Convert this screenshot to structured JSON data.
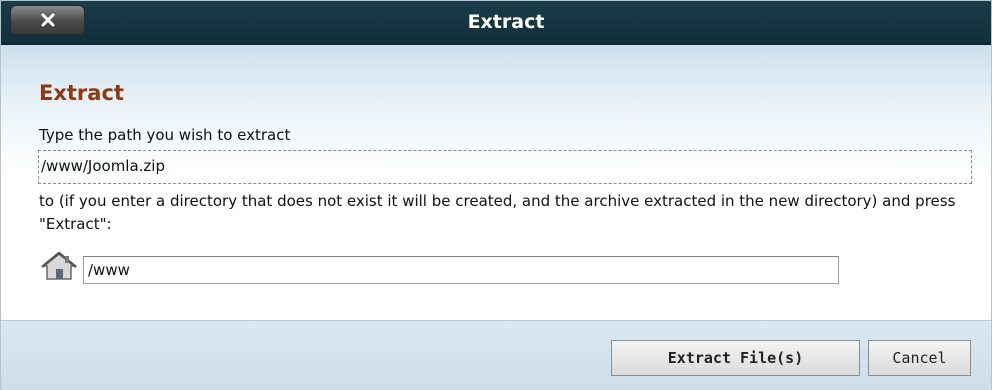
{
  "dialog": {
    "title": "Extract",
    "close_icon": "close-icon"
  },
  "content": {
    "heading": "Extract",
    "source_label": "Type the path you wish to extract",
    "source_path": "/www/Joomla.zip",
    "dest_label": "to (if you enter a directory that does not exist it will be created, and the archive extracted in the new directory) and press \"Extract\":",
    "dest_icon": "home-icon",
    "dest_value": "/www"
  },
  "footer": {
    "extract_label": "Extract File(s)",
    "cancel_label": "Cancel"
  },
  "colors": {
    "titlebar": "#0f2e3a",
    "heading": "#8b3a12"
  }
}
